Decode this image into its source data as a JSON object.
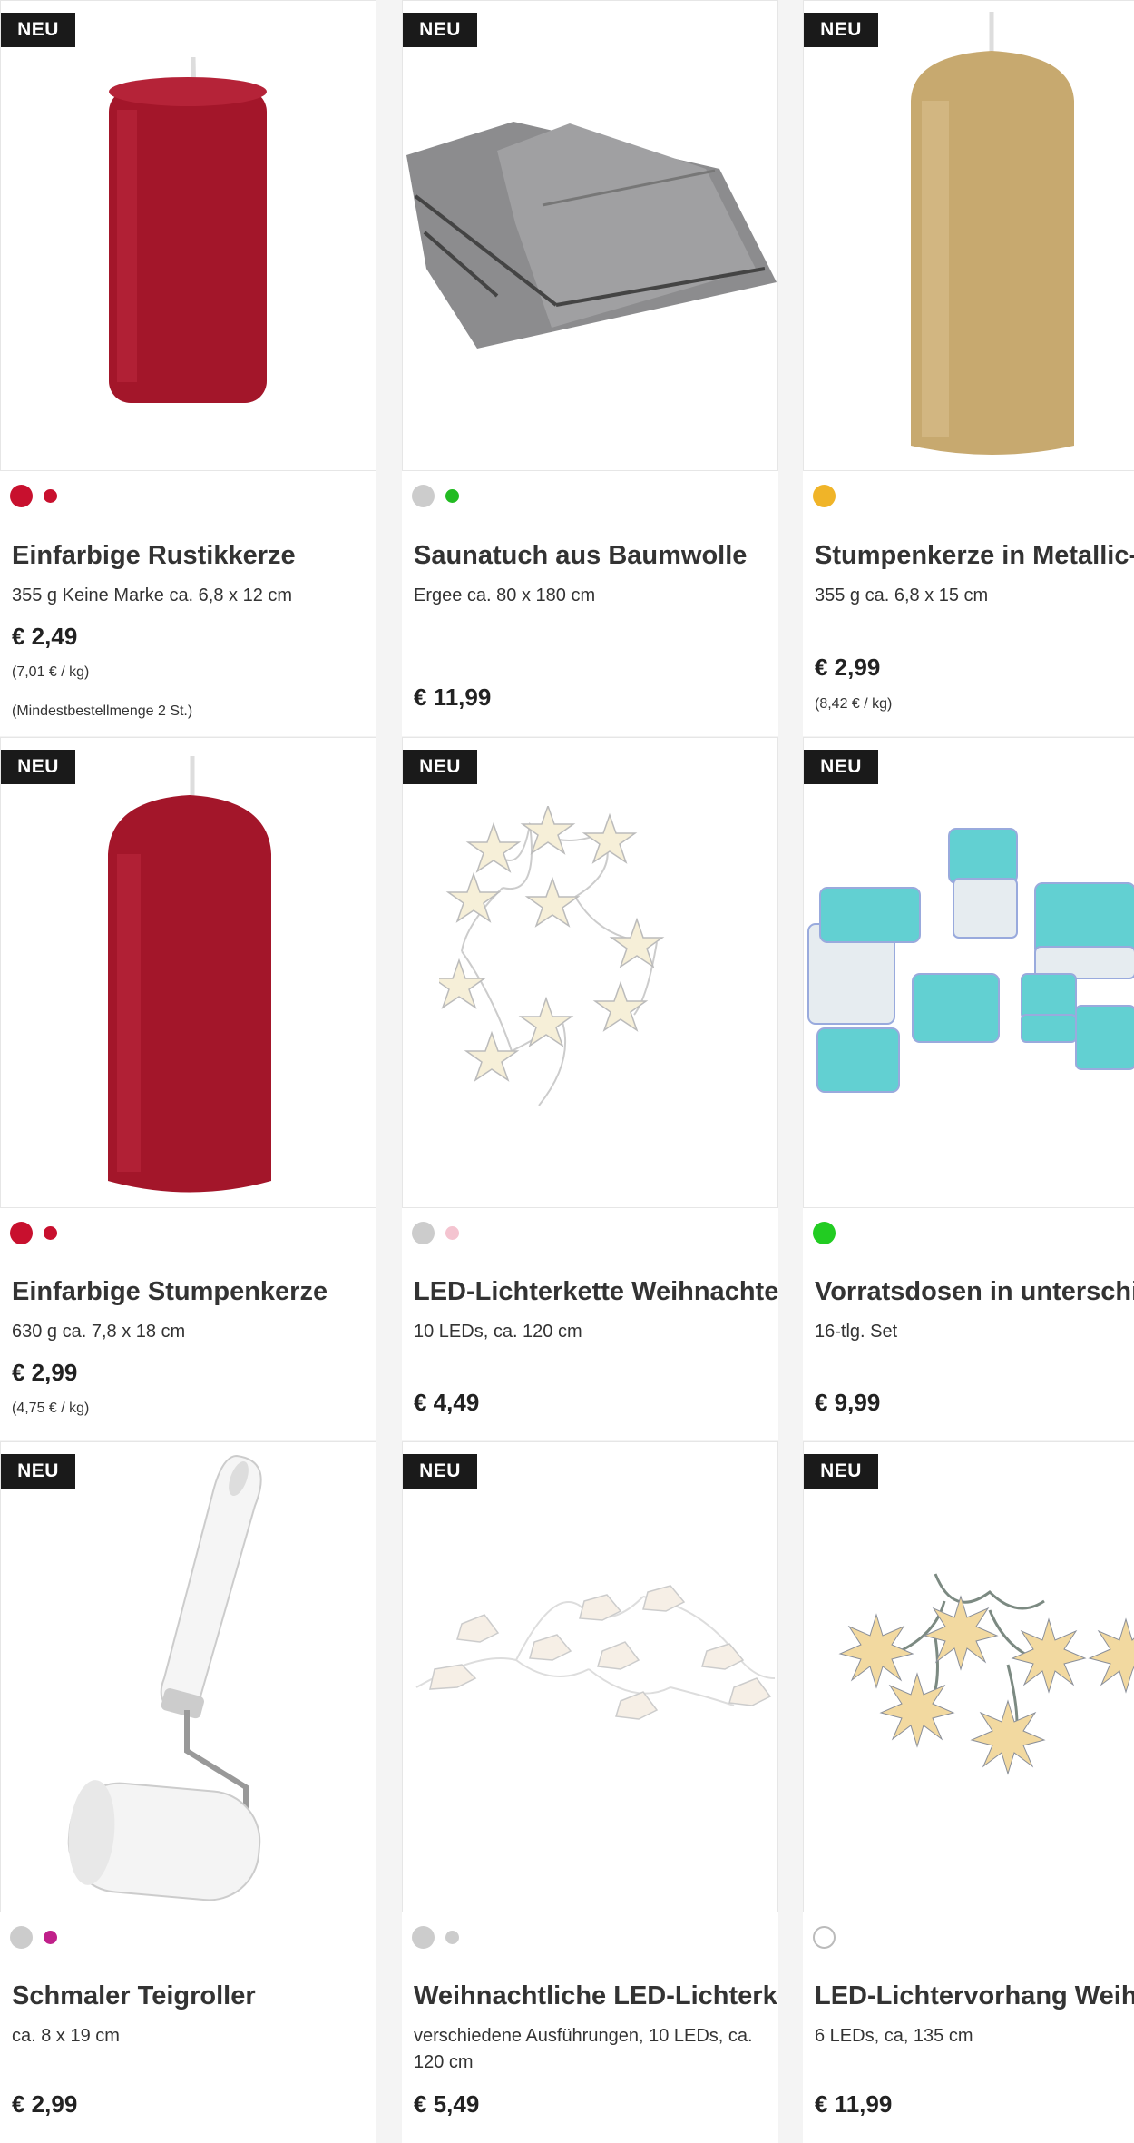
{
  "badge": "NEU",
  "products": [
    {
      "title": "Einfarbige Rustikkerze",
      "desc": "355 g Keine Marke ca. 6,8 x 12 cm",
      "price": "€ 2,49",
      "unit_price": "(7,01 € / kg)",
      "note": "(Mindestbestellmenge 2 St.)",
      "swatches": [
        "#c8102e",
        "#c8102e"
      ]
    },
    {
      "title": "Saunatuch aus Baumwolle",
      "desc": "Ergee ca. 80 x 180 cm",
      "price": "€ 11,99",
      "unit_price": "",
      "note": "",
      "swatches": [
        "#cccccc",
        "#22bb22"
      ]
    },
    {
      "title": "Stumpenkerze in Metallic-Optik",
      "desc": "355 g ca. 6,8 x 15 cm",
      "price": "€ 2,99",
      "unit_price": "(8,42 € / kg)",
      "note": "",
      "swatches": [
        "#f0b428"
      ]
    },
    {
      "title": "Einfarbige Stumpenkerze",
      "desc": "630 g ca. 7,8 x 18 cm",
      "price": "€ 2,99",
      "unit_price": "(4,75 € / kg)",
      "note": "",
      "swatches": [
        "#c8102e",
        "#c8102e"
      ]
    },
    {
      "title": "LED-Lichterkette Weihnachten",
      "desc": "10 LEDs, ca. 120 cm",
      "price": "€ 4,49",
      "unit_price": "",
      "note": "",
      "swatches": [
        "#cccccc",
        "#f4c4d0"
      ]
    },
    {
      "title": "Vorratsdosen in unterschiedlichen Größen",
      "desc": "16-tlg. Set",
      "price": "€ 9,99",
      "unit_price": "",
      "note": "",
      "swatches": [
        "#22cc22"
      ]
    },
    {
      "title": "Schmaler Teigroller",
      "desc": "ca. 8 x 19 cm",
      "price": "€ 2,99",
      "unit_price": "",
      "note": "",
      "swatches": [
        "#cccccc",
        "#c0208a"
      ]
    },
    {
      "title": "Weihnachtliche LED-Lichterket...",
      "desc": "verschiedene Ausführungen, 10 LEDs, ca. 120 cm",
      "price": "€ 5,49",
      "unit_price": "",
      "note": "",
      "swatches": [
        "#cccccc",
        "#cccccc"
      ]
    },
    {
      "title": "LED-Lichtervorhang Weihnachten",
      "desc": "6 LEDs, ca, 135 cm",
      "price": "€ 11,99",
      "unit_price": "",
      "note": "",
      "swatches": [
        "#ffffff"
      ]
    }
  ]
}
